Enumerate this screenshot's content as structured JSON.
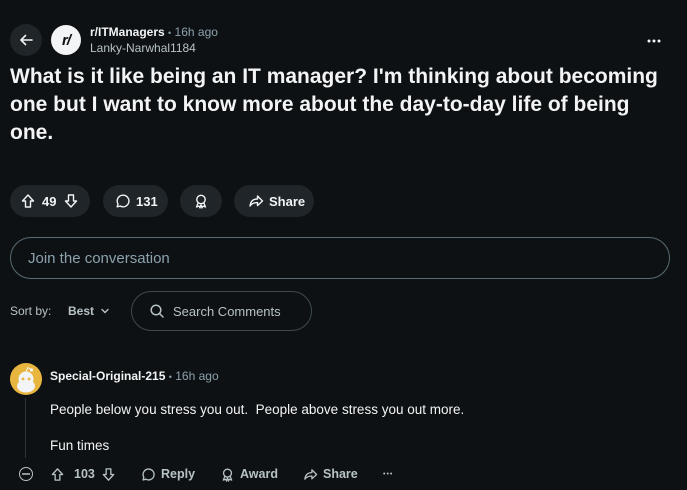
{
  "post": {
    "subreddit": "r/ITManagers",
    "separator": "•",
    "time": "16h ago",
    "author": "Lanky-Narwhal1184",
    "avatar_text": "r/",
    "title": "What is it like being an IT manager? I'm thinking about becoming one but I want to know more about the day-to-day life of being one.",
    "votes": "49",
    "comments": "131",
    "share_label": "Share"
  },
  "composer": {
    "placeholder": "Join the conversation"
  },
  "sort": {
    "label": "Sort by:",
    "value": "Best",
    "search_placeholder": "Search Comments"
  },
  "comment": {
    "author": "Special-Original-215",
    "separator": "•",
    "time": "16h ago",
    "lines": [
      "People below you stress you out.  People above stress you out more.",
      "Fun times"
    ],
    "votes": "103",
    "reply_label": "Reply",
    "award_label": "Award",
    "share_label": "Share",
    "more_label": "•••"
  },
  "colors": {
    "background": "#0e1113",
    "pill": "#1f2528",
    "avatar_yellow": "#e8b53f"
  }
}
